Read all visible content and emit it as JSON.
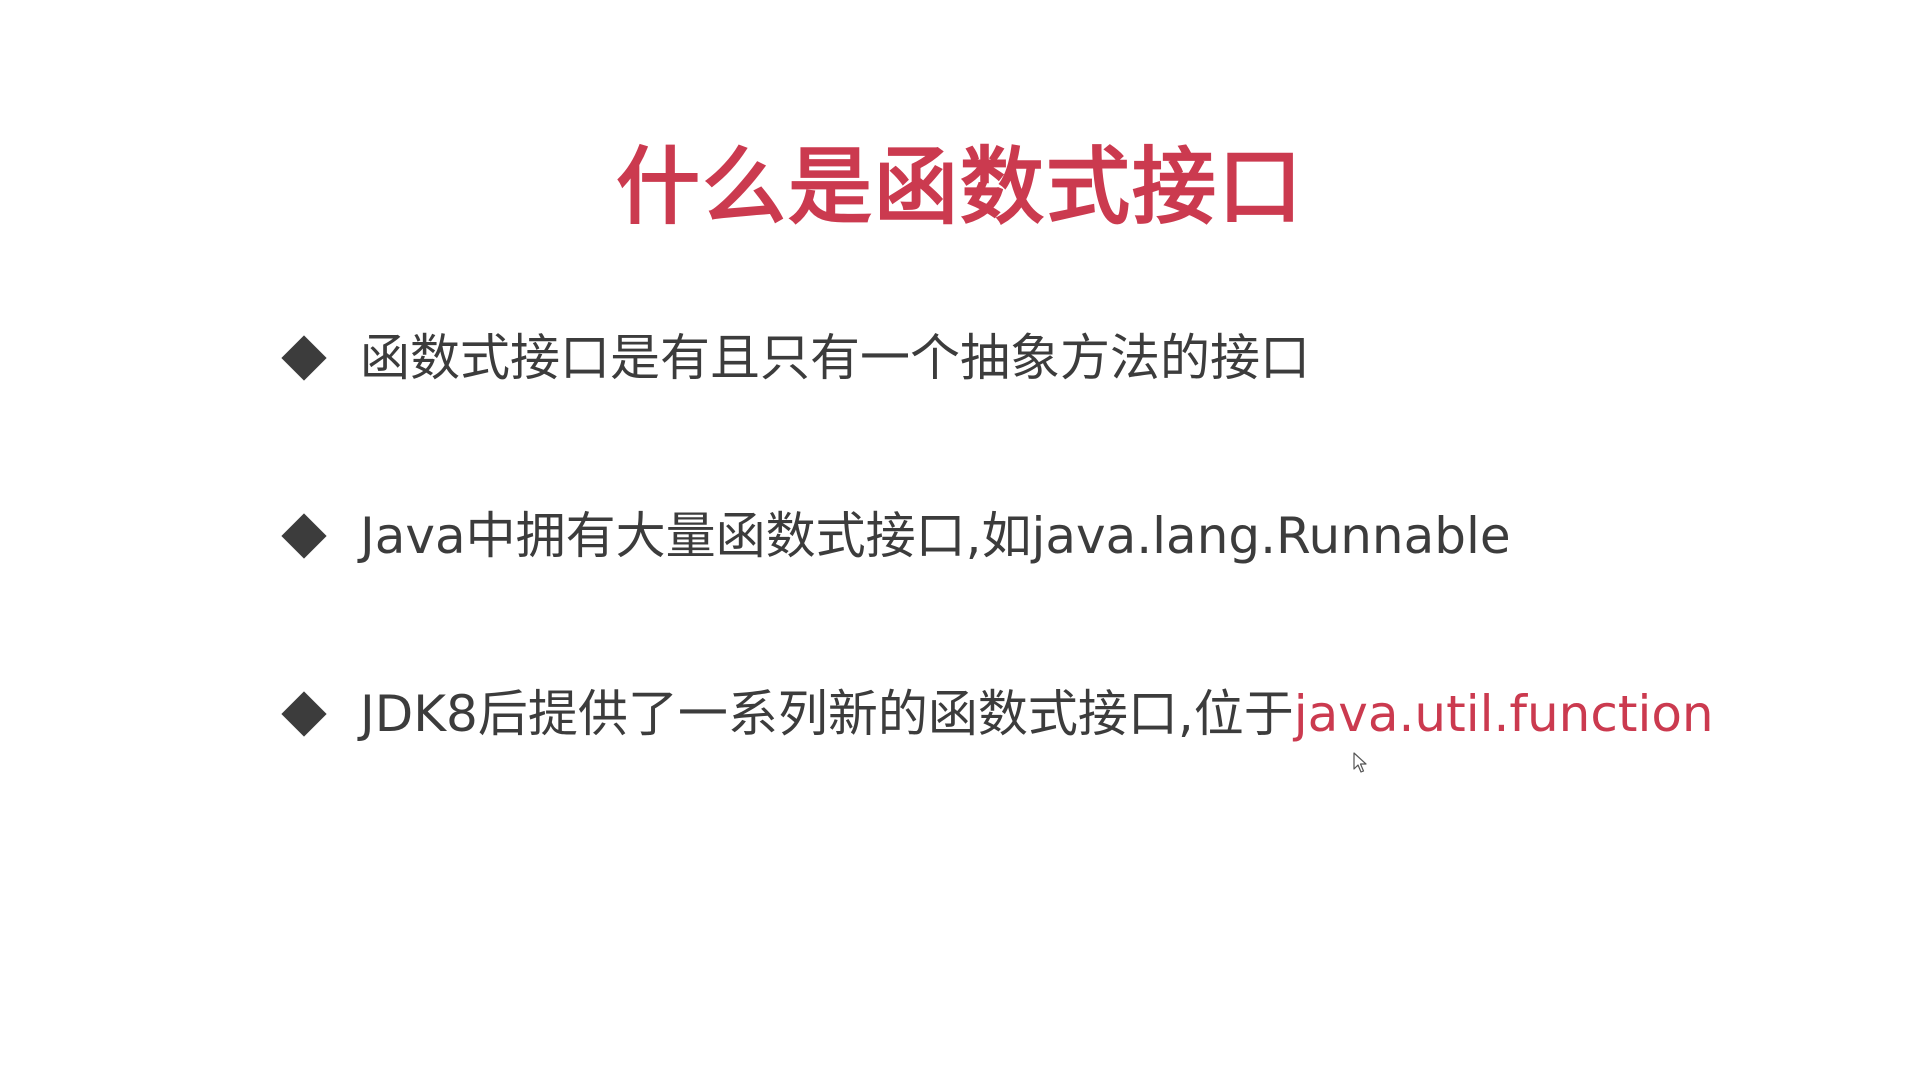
{
  "slide": {
    "title": "什么是函数式接口",
    "bullets": [
      {
        "text": "函数式接口是有且只有一个抽象方法的接口",
        "highlight": ""
      },
      {
        "text": "Java中拥有大量函数式接口,如java.lang.Runnable",
        "highlight": ""
      },
      {
        "text": "JDK8后提供了一系列新的函数式接口,位于",
        "highlight": "java.util.function"
      }
    ]
  },
  "icons": {
    "bullet": "diamond-bullet-icon",
    "cursor": "mouse-pointer-icon"
  },
  "colors": {
    "accent": "#cb3a4f",
    "text": "#3c3c3c",
    "bullet": "#3c3c3c",
    "background": "#ffffff"
  }
}
